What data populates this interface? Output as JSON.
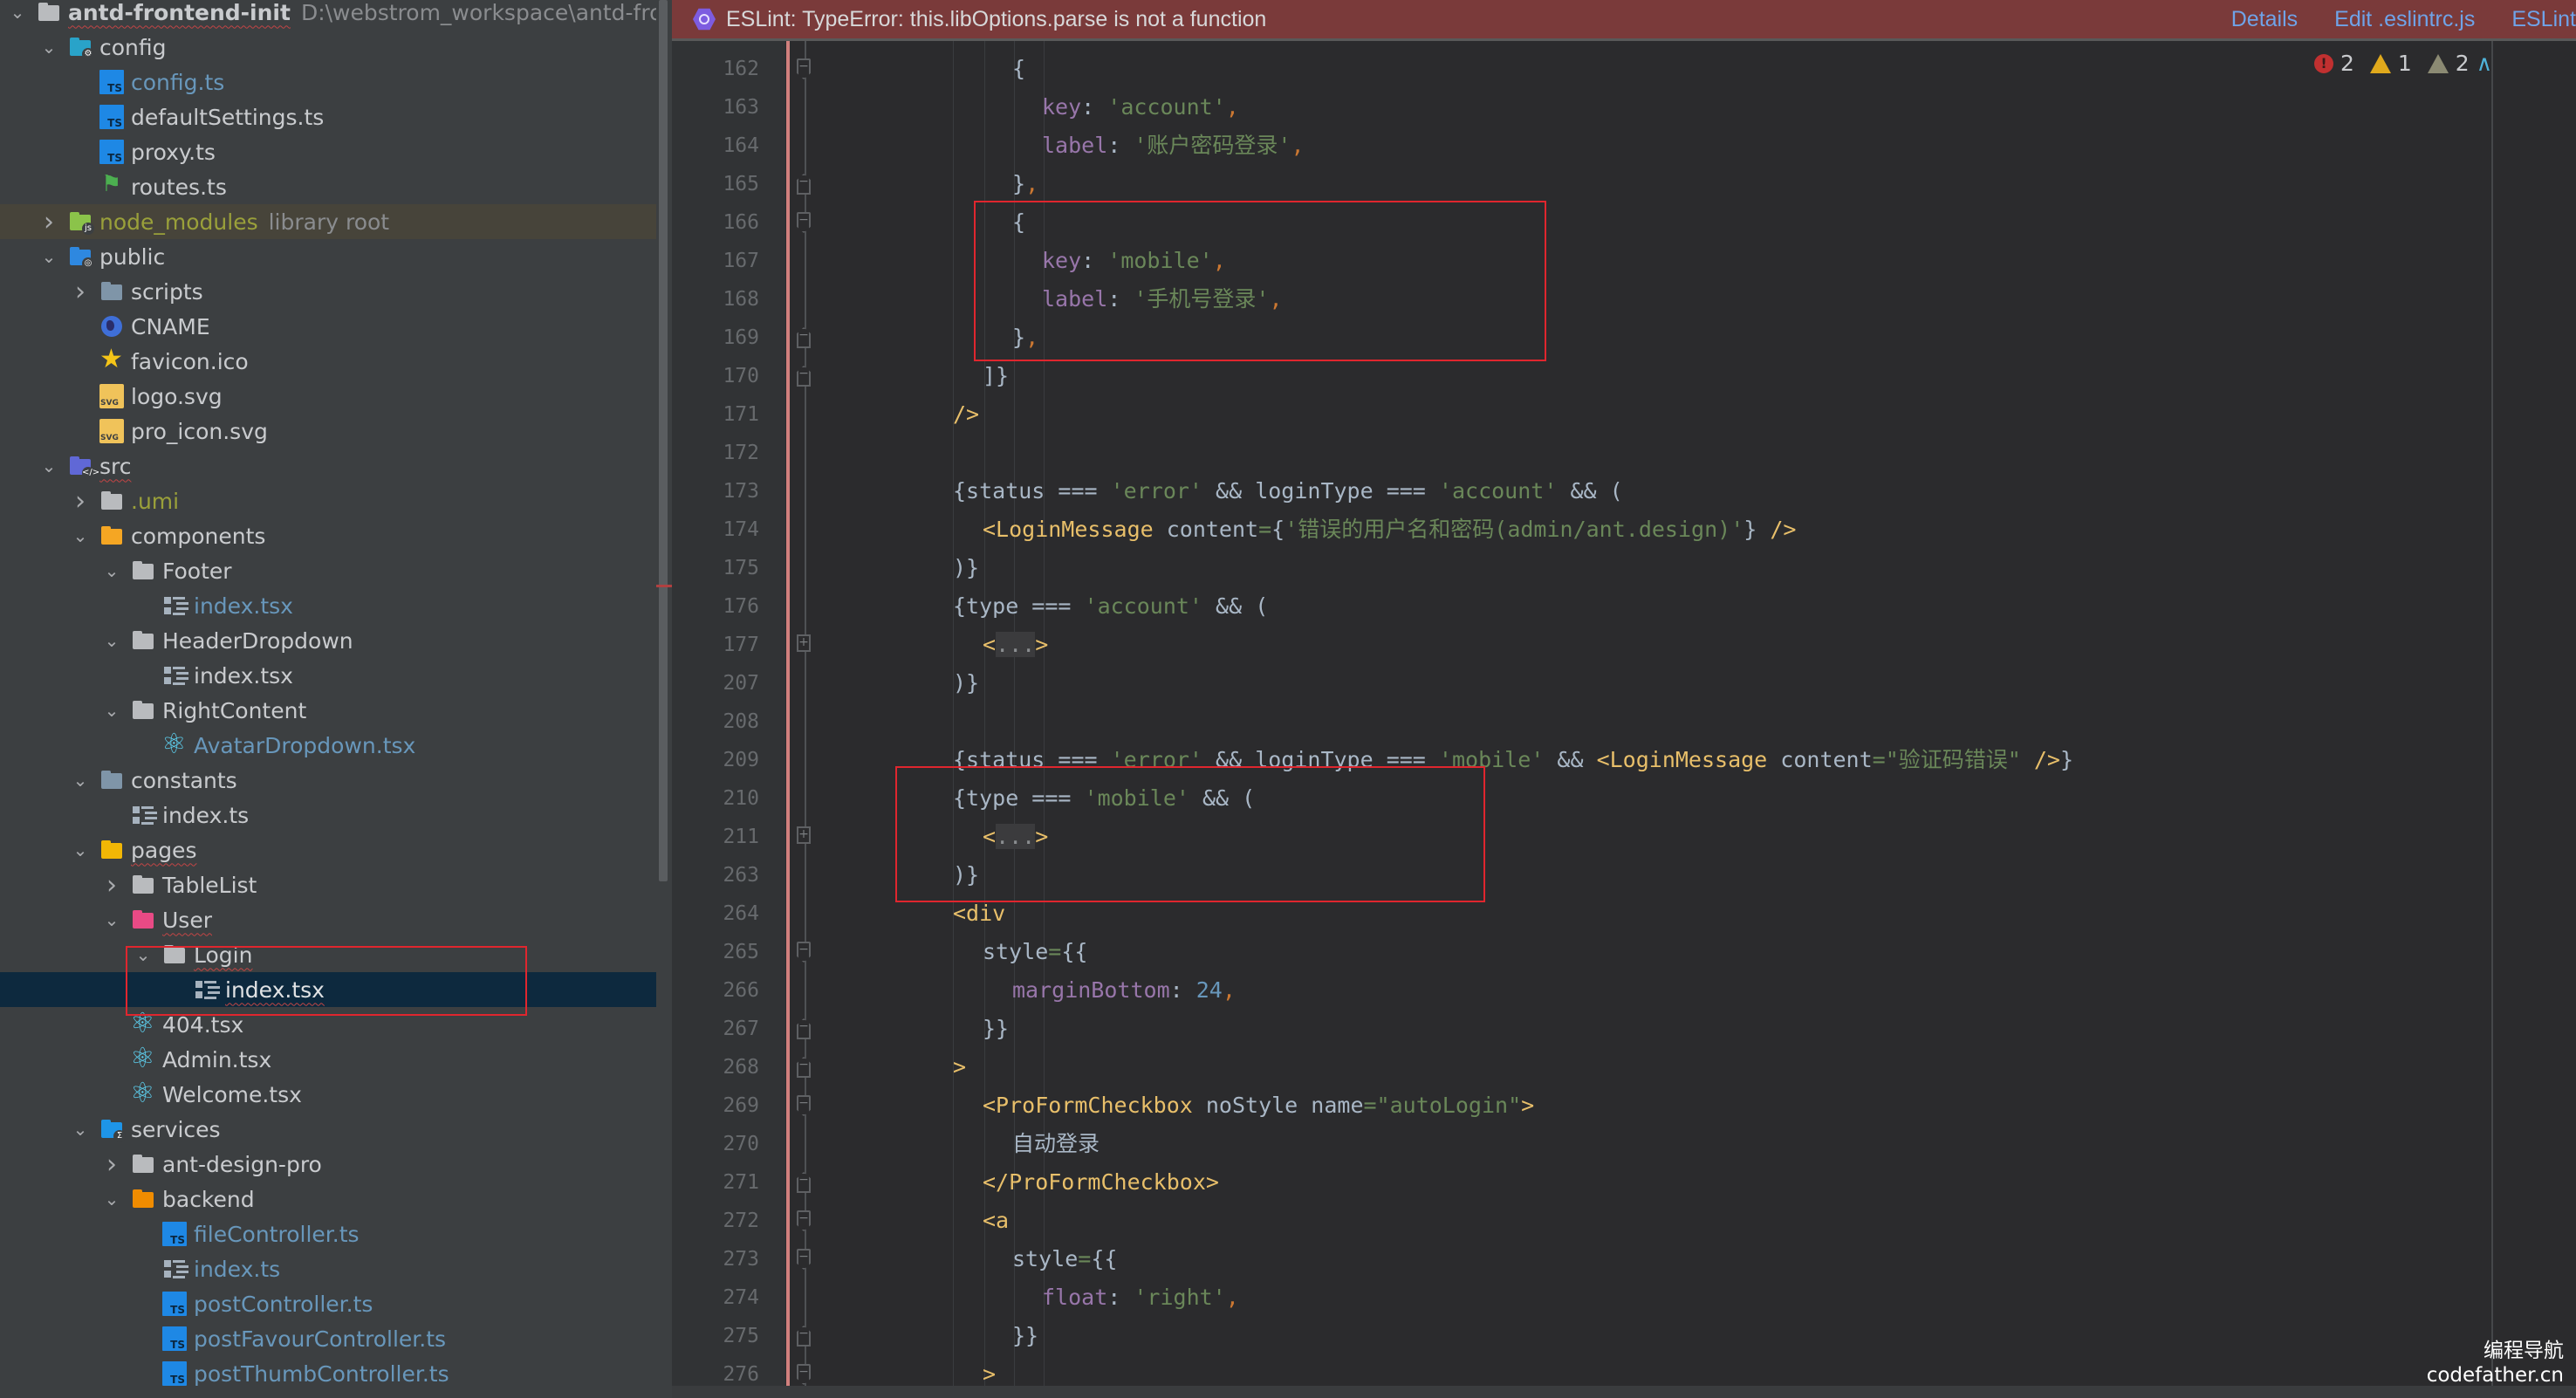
{
  "project": {
    "root_name": "antd-frontend-init",
    "root_path": "D:\\webstrom_workspace\\antd-frontend-init"
  },
  "tree": [
    {
      "depth": 0,
      "chev": "down",
      "icon": "folder",
      "name": "antd-frontend-init",
      "hint": "D:\\webstrom_workspace\\antd-frontend-init",
      "bold": true,
      "squig": true
    },
    {
      "depth": 1,
      "chev": "down",
      "icon": "folder-cyan",
      "badge": "⚙",
      "name": "config"
    },
    {
      "depth": 2,
      "icon": "ts",
      "name": "config.ts",
      "style": "blue"
    },
    {
      "depth": 2,
      "icon": "ts",
      "name": "defaultSettings.ts"
    },
    {
      "depth": 2,
      "icon": "routes",
      "name": "proxy.ts",
      "iconOverride": "ts"
    },
    {
      "depth": 2,
      "icon": "routes",
      "name": "routes.ts"
    },
    {
      "depth": 1,
      "chev": "right",
      "icon": "folder-green",
      "badge": "js",
      "name": "node_modules",
      "style": "olive",
      "hint": "library root",
      "lib": true
    },
    {
      "depth": 1,
      "chev": "down",
      "icon": "folder-blue",
      "badge": "◎",
      "name": "public"
    },
    {
      "depth": 2,
      "chev": "right",
      "icon": "folder-slate",
      "name": "scripts"
    },
    {
      "depth": 2,
      "icon": "globe",
      "name": "CNAME"
    },
    {
      "depth": 2,
      "icon": "star",
      "name": "favicon.ico"
    },
    {
      "depth": 2,
      "icon": "svg",
      "name": "logo.svg"
    },
    {
      "depth": 2,
      "icon": "svg",
      "name": "pro_icon.svg"
    },
    {
      "depth": 1,
      "chev": "down",
      "icon": "folder-indigo",
      "badge": "</>",
      "name": "src",
      "squig": true
    },
    {
      "depth": 2,
      "chev": "right",
      "icon": "folder",
      "name": ".umi",
      "style": "olive"
    },
    {
      "depth": 2,
      "chev": "down",
      "icon": "folder-orange",
      "name": "components"
    },
    {
      "depth": 3,
      "chev": "down",
      "icon": "folder",
      "name": "Footer"
    },
    {
      "depth": 4,
      "icon": "lines",
      "name": "index.tsx",
      "style": "blue"
    },
    {
      "depth": 3,
      "chev": "down",
      "icon": "folder",
      "name": "HeaderDropdown"
    },
    {
      "depth": 4,
      "icon": "lines",
      "name": "index.tsx"
    },
    {
      "depth": 3,
      "chev": "down",
      "icon": "folder",
      "name": "RightContent"
    },
    {
      "depth": 4,
      "icon": "react",
      "name": "AvatarDropdown.tsx",
      "style": "blue"
    },
    {
      "depth": 2,
      "chev": "down",
      "icon": "folder-slate",
      "name": "constants"
    },
    {
      "depth": 3,
      "icon": "lines",
      "name": "index.ts"
    },
    {
      "depth": 2,
      "chev": "down",
      "icon": "folder-yellow",
      "name": "pages",
      "squig": true
    },
    {
      "depth": 3,
      "chev": "right",
      "icon": "folder",
      "name": "TableList"
    },
    {
      "depth": 3,
      "chev": "down",
      "icon": "folder-pink",
      "name": "User",
      "squig": true
    },
    {
      "depth": 4,
      "chev": "down",
      "icon": "folder",
      "name": "Login",
      "squig": true
    },
    {
      "depth": 5,
      "icon": "lines",
      "name": "index.tsx",
      "squig": true,
      "selected": true
    },
    {
      "depth": 3,
      "icon": "react",
      "name": "404.tsx"
    },
    {
      "depth": 3,
      "icon": "react",
      "name": "Admin.tsx"
    },
    {
      "depth": 3,
      "icon": "react",
      "name": "Welcome.tsx"
    },
    {
      "depth": 2,
      "chev": "down",
      "icon": "folder-sky",
      "badge": "Σ",
      "name": "services"
    },
    {
      "depth": 3,
      "chev": "right",
      "icon": "folder",
      "name": "ant-design-pro"
    },
    {
      "depth": 3,
      "chev": "down",
      "icon": "folder-amber",
      "name": "backend"
    },
    {
      "depth": 4,
      "icon": "ts",
      "name": "fileController.ts",
      "style": "blue"
    },
    {
      "depth": 4,
      "icon": "lines",
      "name": "index.ts",
      "style": "blue"
    },
    {
      "depth": 4,
      "icon": "ts",
      "name": "postController.ts",
      "style": "blue"
    },
    {
      "depth": 4,
      "icon": "ts",
      "name": "postFavourController.ts",
      "style": "blue"
    },
    {
      "depth": 4,
      "icon": "ts",
      "name": "postThumbController.ts",
      "style": "blue"
    }
  ],
  "banner": {
    "message": "ESLint: TypeError: this.libOptions.parse is not a function",
    "links": [
      "Details",
      "Edit .eslintrc.js",
      "ESLint"
    ],
    "color": "#7a3a3a"
  },
  "inspections": {
    "errors": "2",
    "warnings": "1",
    "weak_warnings": "2"
  },
  "editor": {
    "lines": [
      {
        "n": "162",
        "fold": "open",
        "indent": 2,
        "tokens": [
          [
            "plain",
            "{"
          ]
        ]
      },
      {
        "n": "163",
        "indent": 3,
        "tokens": [
          [
            "prop",
            "key"
          ],
          [
            "plain",
            ": "
          ],
          [
            "str",
            "'account'"
          ],
          [
            "comma",
            ","
          ]
        ]
      },
      {
        "n": "164",
        "indent": 3,
        "tokens": [
          [
            "prop",
            "label"
          ],
          [
            "plain",
            ": "
          ],
          [
            "str",
            "'账户密码登录'"
          ],
          [
            "comma",
            ","
          ]
        ]
      },
      {
        "n": "165",
        "fold": "close",
        "indent": 2,
        "tokens": [
          [
            "plain",
            "}"
          ],
          [
            "comma",
            ","
          ]
        ]
      },
      {
        "n": "166",
        "fold": "open",
        "indent": 2,
        "tokens": [
          [
            "plain",
            "{"
          ]
        ]
      },
      {
        "n": "167",
        "indent": 3,
        "tokens": [
          [
            "prop",
            "key"
          ],
          [
            "plain",
            ": "
          ],
          [
            "str",
            "'mobile'"
          ],
          [
            "comma",
            ","
          ]
        ]
      },
      {
        "n": "168",
        "indent": 3,
        "tokens": [
          [
            "prop",
            "label"
          ],
          [
            "plain",
            ": "
          ],
          [
            "str",
            "'手机号登录'"
          ],
          [
            "comma",
            ","
          ]
        ]
      },
      {
        "n": "169",
        "fold": "close",
        "indent": 2,
        "tokens": [
          [
            "plain",
            "}"
          ],
          [
            "comma",
            ","
          ]
        ]
      },
      {
        "n": "170",
        "fold": "close",
        "indent": 1,
        "tokens": [
          [
            "plain",
            "]}"
          ]
        ]
      },
      {
        "n": "171",
        "indent": 0,
        "tokens": [
          [
            "tag",
            "/>"
          ]
        ]
      },
      {
        "n": "172",
        "indent": 0,
        "tokens": []
      },
      {
        "n": "173",
        "indent": 0,
        "tokens": [
          [
            "plain",
            "{status === "
          ],
          [
            "str",
            "'error'"
          ],
          [
            "plain",
            " && loginType === "
          ],
          [
            "str",
            "'account'"
          ],
          [
            "plain",
            " && ("
          ]
        ]
      },
      {
        "n": "174",
        "indent": 1,
        "tokens": [
          [
            "tag",
            "<LoginMessage"
          ],
          [
            "plain",
            " content"
          ],
          [
            "str",
            "="
          ],
          [
            "plain",
            "{"
          ],
          [
            "str",
            "'错误的用户名和密码(admin/ant.design)'"
          ],
          [
            "plain",
            "} "
          ],
          [
            "tag",
            "/>"
          ]
        ]
      },
      {
        "n": "175",
        "indent": 0,
        "tokens": [
          [
            "plain",
            ")}"
          ]
        ]
      },
      {
        "n": "176",
        "indent": 0,
        "tokens": [
          [
            "plain",
            "{type === "
          ],
          [
            "str",
            "'account'"
          ],
          [
            "plain",
            " && ("
          ]
        ]
      },
      {
        "n": "177",
        "fold": "plus",
        "indent": 1,
        "tokens": [
          [
            "tag",
            "<"
          ],
          [
            "fold",
            "..."
          ],
          [
            "tag",
            ">"
          ]
        ]
      },
      {
        "n": "207",
        "indent": 0,
        "tokens": [
          [
            "plain",
            ")}"
          ]
        ]
      },
      {
        "n": "208",
        "indent": 0,
        "tokens": []
      },
      {
        "n": "209",
        "indent": 0,
        "tokens": [
          [
            "plain",
            "{status === "
          ],
          [
            "str",
            "'error'"
          ],
          [
            "plain",
            " && loginType === "
          ],
          [
            "str",
            "'mobile'"
          ],
          [
            "plain",
            " && "
          ],
          [
            "tag",
            "<LoginMessage"
          ],
          [
            "plain",
            " content"
          ],
          [
            "str",
            "=\"验证码错误\""
          ],
          [
            "plain",
            " "
          ],
          [
            "tag",
            "/>"
          ],
          [
            "plain",
            "}"
          ]
        ]
      },
      {
        "n": "210",
        "indent": 0,
        "tokens": [
          [
            "plain",
            "{type === "
          ],
          [
            "str",
            "'mobile'"
          ],
          [
            "plain",
            " && ("
          ]
        ]
      },
      {
        "n": "211",
        "fold": "plus",
        "indent": 1,
        "tokens": [
          [
            "tag",
            "<"
          ],
          [
            "fold",
            "..."
          ],
          [
            "tag",
            ">"
          ]
        ]
      },
      {
        "n": "263",
        "indent": 0,
        "tokens": [
          [
            "plain",
            ")}"
          ]
        ]
      },
      {
        "n": "264",
        "indent": 0,
        "tokens": [
          [
            "tag",
            "<div"
          ]
        ]
      },
      {
        "n": "265",
        "fold": "open",
        "indent": 1,
        "tokens": [
          [
            "plain",
            "style"
          ],
          [
            "str",
            "="
          ],
          [
            "plain",
            "{{"
          ]
        ]
      },
      {
        "n": "266",
        "indent": 2,
        "tokens": [
          [
            "prop",
            "marginBottom"
          ],
          [
            "plain",
            ": "
          ],
          [
            "num",
            "24"
          ],
          [
            "comma",
            ","
          ]
        ]
      },
      {
        "n": "267",
        "fold": "close",
        "indent": 1,
        "tokens": [
          [
            "plain",
            "}}"
          ]
        ]
      },
      {
        "n": "268",
        "fold": "close",
        "indent": 0,
        "tokens": [
          [
            "tag",
            ">"
          ]
        ]
      },
      {
        "n": "269",
        "fold": "open",
        "indent": 1,
        "tokens": [
          [
            "tag",
            "<ProFormCheckbox"
          ],
          [
            "plain",
            " noStyle name"
          ],
          [
            "str",
            "=\"autoLogin\""
          ],
          [
            "tag",
            ">"
          ]
        ]
      },
      {
        "n": "270",
        "indent": 2,
        "tokens": [
          [
            "plain",
            "自动登录"
          ]
        ]
      },
      {
        "n": "271",
        "fold": "close",
        "indent": 1,
        "tokens": [
          [
            "tag",
            "</ProFormCheckbox>"
          ]
        ]
      },
      {
        "n": "272",
        "fold": "open",
        "indent": 1,
        "tokens": [
          [
            "tag",
            "<a"
          ]
        ]
      },
      {
        "n": "273",
        "fold": "open",
        "indent": 2,
        "tokens": [
          [
            "plain",
            "style"
          ],
          [
            "str",
            "="
          ],
          [
            "plain",
            "{{"
          ]
        ]
      },
      {
        "n": "274",
        "indent": 3,
        "tokens": [
          [
            "prop",
            "float"
          ],
          [
            "plain",
            ": "
          ],
          [
            "str",
            "'right'"
          ],
          [
            "comma",
            ","
          ]
        ]
      },
      {
        "n": "275",
        "fold": "close",
        "indent": 2,
        "tokens": [
          [
            "plain",
            "}}"
          ]
        ]
      },
      {
        "n": "276",
        "fold": "open",
        "indent": 1,
        "tokens": [
          [
            "tag",
            ">"
          ]
        ]
      }
    ]
  },
  "watermark": {
    "line1": "编程导航",
    "line2": "codefather.cn"
  }
}
